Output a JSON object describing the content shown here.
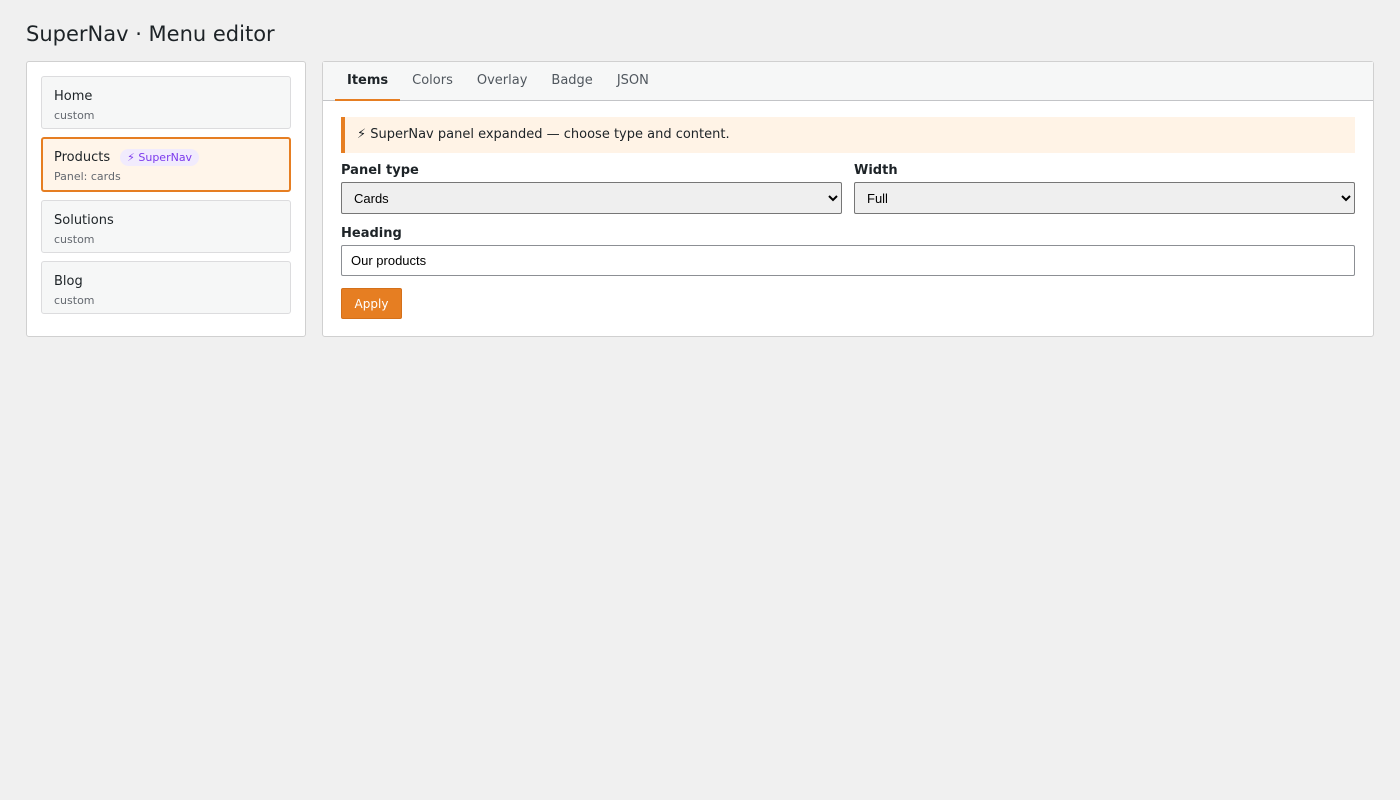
{
  "header": {
    "title": "SuperNav · Menu editor"
  },
  "sidebar": {
    "items": [
      {
        "title": "Home",
        "subtitle": "custom"
      },
      {
        "title": "Products",
        "subtitle": "Panel: cards",
        "badge_icon": "lightning-icon",
        "badge": "⚡ SuperNav",
        "active": true
      },
      {
        "title": "Solutions",
        "subtitle": "custom"
      },
      {
        "title": "Blog",
        "subtitle": "custom"
      }
    ]
  },
  "main": {
    "tabs": [
      {
        "label": "Items",
        "active": true
      },
      {
        "label": "Colors"
      },
      {
        "label": "Overlay"
      },
      {
        "label": "Badge"
      },
      {
        "label": "JSON"
      }
    ],
    "notice": "⚡ SuperNav panel expanded — choose type and content.",
    "form": {
      "panel_type_label": "Panel type",
      "panel_type_value": "Cards",
      "width_label": "Width",
      "width_value": "Full",
      "heading_label": "Heading",
      "heading_value": "Our products",
      "apply_label": "Apply"
    }
  },
  "colors": {
    "accent": "#e67e22",
    "badge_text": "#7c3aed",
    "badge_bg": "#f1ebfd",
    "notice_bg": "#fff3e6"
  }
}
